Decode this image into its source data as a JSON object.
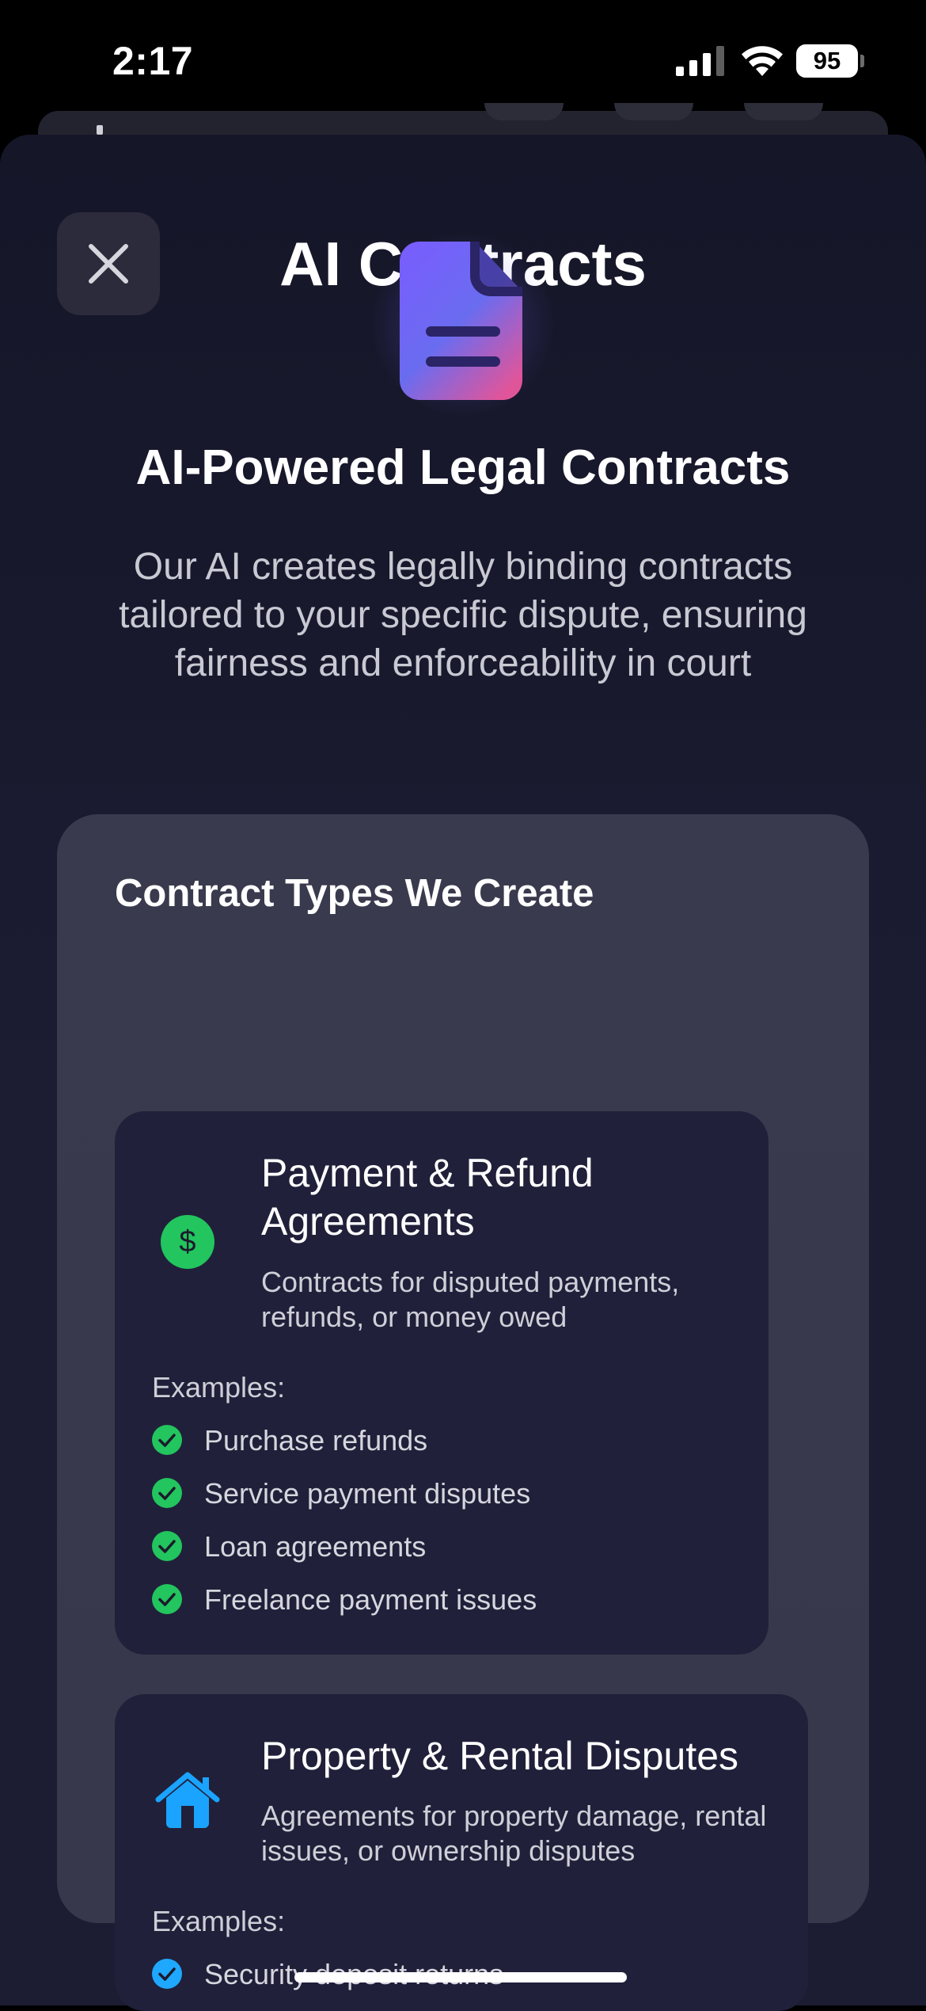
{
  "status_bar": {
    "time": "2:17",
    "battery": "95"
  },
  "sheet": {
    "title": "AI Contracts",
    "close_icon": "close-icon"
  },
  "hero": {
    "icon": "document-icon",
    "title": "AI-Powered Legal Contracts",
    "description": "Our AI creates legally binding contracts tailored to your specific dispute, ensuring fairness and enforceability in court"
  },
  "contract_types": {
    "heading": "Contract Types We Create",
    "items": [
      {
        "icon": "dollar-icon",
        "title": "Payment & Refund Agreements",
        "description": "Contracts for disputed payments, refunds, or money owed",
        "examples_label": "Examples:",
        "examples": [
          "Purchase refunds",
          "Service payment disputes",
          "Loan agreements",
          "Freelance payment issues"
        ],
        "check_color": "#2ecc6a"
      },
      {
        "icon": "house-icon",
        "title": "Property & Rental Disputes",
        "description": "Agreements for property damage, rental issues, or ownership disputes",
        "examples_label": "Examples:",
        "examples": [
          "Security deposit returns"
        ],
        "check_color": "#1fa8ff"
      }
    ]
  },
  "colors": {
    "accent_green": "#22c55e",
    "accent_blue": "#1aa3ff",
    "sheet_bg": "#1c1c33"
  }
}
